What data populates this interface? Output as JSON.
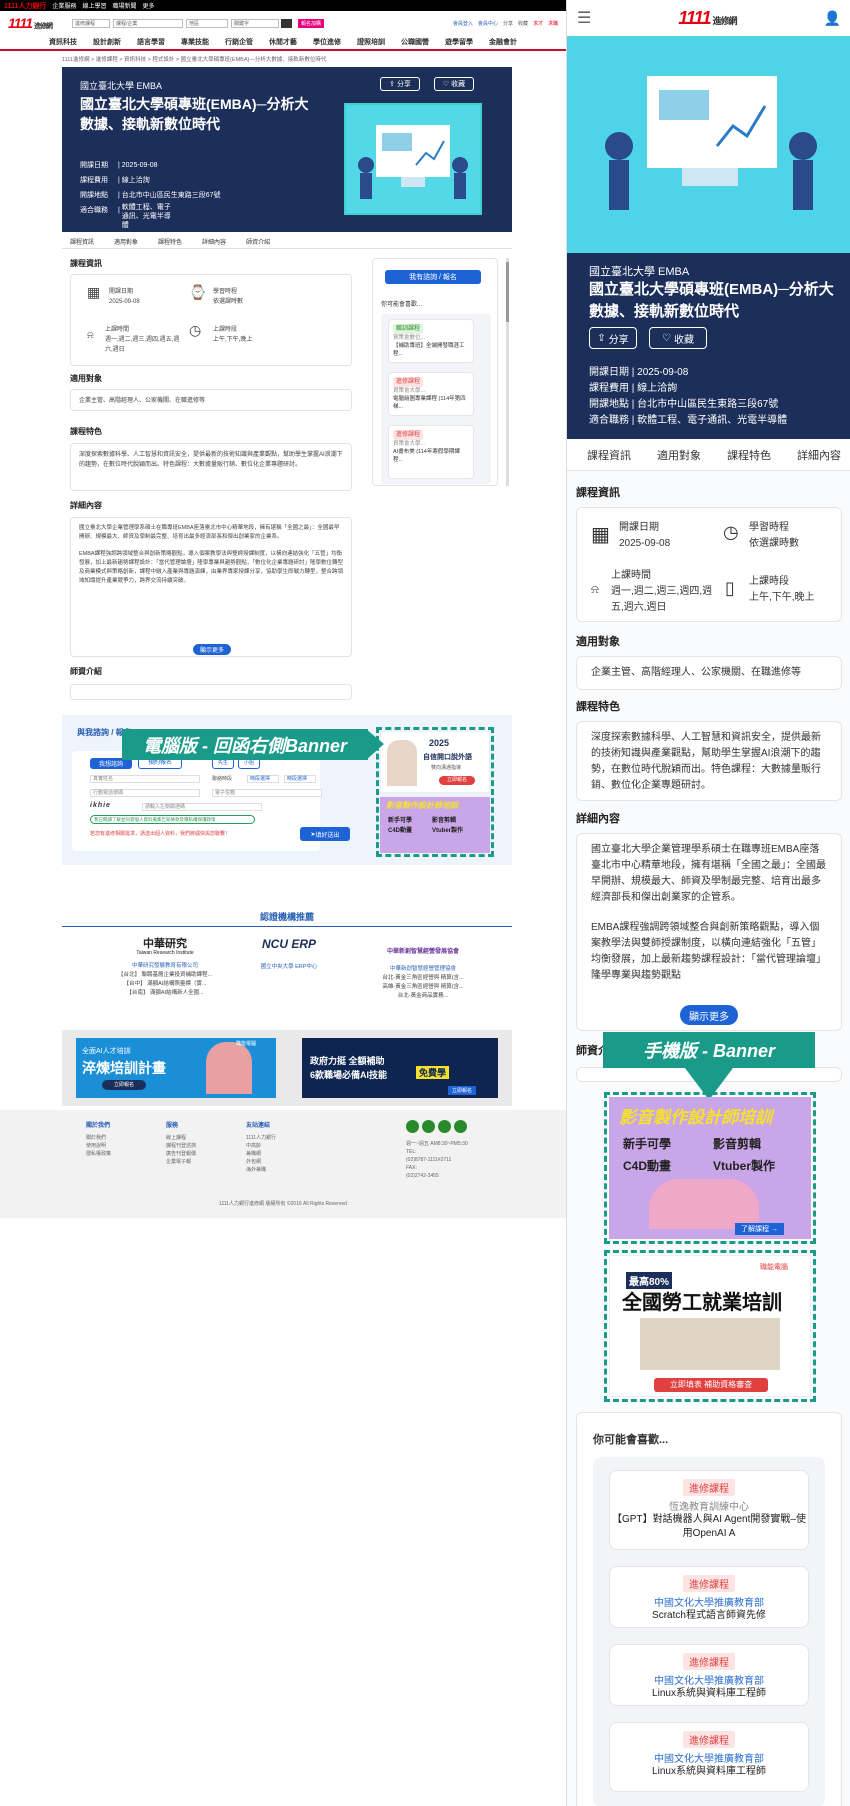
{
  "colors": {
    "navy": "#1c2f5a",
    "brand_red": "#e60012",
    "teal": "#1a9b8a",
    "blue": "#1e63d6",
    "cyan": "#4ed3e8"
  },
  "desktop": {
    "topstrip": [
      "1111人力銀行",
      "企業服務",
      "線上學習",
      "職場新聞",
      "更多"
    ],
    "logo": "1111",
    "logo_sub": "進修網",
    "header": {
      "select1": "進修課程",
      "select2": "課程/企業",
      "select3": "地區",
      "search_placeholder": "關鍵字",
      "pill": "報名加購",
      "links": [
        "會員登入",
        "會員中心",
        "分享",
        "收藏",
        "求才",
        "求職"
      ]
    },
    "nav": [
      "資訊科技",
      "設計創新",
      "語言學習",
      "專業技能",
      "行銷企管",
      "休閒才藝",
      "學位進修",
      "證照培訓",
      "公職國營",
      "遊學留學",
      "金融會計"
    ],
    "breadcrumb": "1111進修網 > 進修課程 > 資訊科技 > 程式設計 > 國立臺北大學碩專班(EMBA)—分析大數據、接軌新數位時代",
    "hero": {
      "school": "國立臺北大學 EMBA",
      "title": "國立臺北大學碩專班(EMBA)─分析大數據、接軌新數位時代",
      "share": "分享",
      "fav": "收藏",
      "info": [
        {
          "k": "開課日期",
          "v": "2025-09-08"
        },
        {
          "k": "課程費用",
          "v": "線上洽詢"
        },
        {
          "k": "開課地點",
          "v": "台北市中山區民生東路三段67號"
        },
        {
          "k": "適合職務",
          "v": "軟體工程、電子通訊、光電半導體"
        }
      ]
    },
    "tabs": [
      "課程資訊",
      "適用對象",
      "課程特色",
      "詳細內容",
      "師資介紹"
    ],
    "course_info": {
      "title": "課程資訊",
      "start_label": "開課日期",
      "start_value": "2025-09-08",
      "hours_label": "學習時程",
      "hours_value": "依選課時數",
      "days_label": "上課時間",
      "days_value": "週一,週二,週三,週四,週五,週六,週日",
      "period_label": "上課時段",
      "period_value": "上午,下午,晚上"
    },
    "target": {
      "title": "適用對象",
      "text": "企業主管、高階經理人、公家機關、在職進修等"
    },
    "feature": {
      "title": "課程特色",
      "text": "深度探索數據科學、人工智慧和資訊安全，提供最新的技術知識與產業觀點，幫助學生掌握AI浪潮下的趨勢，在數位時代脫穎而出。特色課程：大數據量販行銷、數位化企業專題研討。"
    },
    "detail": {
      "title": "詳細內容",
      "text1": "國立臺北大學企業管理學系碩士在職專班EMBA座落臺北市中心精華地段，擁有堪稱「全國之最」：全國最早開辦、規模最大、師資及學制最完整、培育出最多經濟部長和傑出創業家的企業系。",
      "text2": "EMBA課程強調跨領域整合與創新策略觀點，導入個案教學法與雙師授課制度，以橫向連結強化「五管」均衡發展，加上最新趨勢課程設計：「當代管理論壇」隆學專業與趨勢觀點，「數位化企業專題研討」隆學數位轉型及商業模式與策略創新，課程中融入產業與專題演練，由業界專家授課分享，協助學生即戰力轉型，整合跨領域知識提升產業競爭力，跨界交流持續突破。",
      "more": "顯示更多"
    },
    "teacher": {
      "title": "師資介紹"
    },
    "side": {
      "apply": "我有諮詢 / 報名",
      "like_title": "你可能會喜歡...",
      "cards": [
        {
          "tag": "職訓課程",
          "org": "資策會數位...",
          "title": "【補助專班】全端開發職涯工程..."
        },
        {
          "tag": "進修課程",
          "org": "資策會大學...",
          "title": "電腦繪圖專業課程 (114年第四梯..."
        },
        {
          "tag": "進修課程",
          "org": "資策會大學...",
          "title": "AI畫布美 (114年寒假學期課程..."
        }
      ]
    },
    "form": {
      "title": "與我諮詢 / 報名",
      "tab1": "我想諮詢",
      "tab2": "預約報名",
      "gender1": "先生",
      "gender2": "小姐",
      "name_ph": "真實姓名",
      "time_label": "聯絡時段",
      "time1": "時段選擇",
      "time2": "時段選擇",
      "phone_ph": "行動電話號碼",
      "email_ph": "電子信箱",
      "captcha": "ikhie",
      "captcha_ph": "請輸入左側驗證碼",
      "agree": "我已閱讀了解並同意個人資料蒐集告知條款及隱私權保護政策",
      "note": "若您有進修相關需求，請送出個人資料，我們將儘快與您聯繫！",
      "submit": "填好送出"
    },
    "banner_label": "電腦版 - 回函右側Banner",
    "ad1": {
      "year": "2025",
      "title": "自信開口說外語",
      "sub": "雙向溝通指導",
      "cta": "立即報名"
    },
    "ad2": {
      "title": "影音製作設計師培訓",
      "items": [
        "新手可學",
        "影音剪輯",
        "C4D動畫",
        "Vtuber製作"
      ]
    },
    "cert": {
      "title": "認證機構推薦",
      "items": [
        {
          "name": "中華研究",
          "en": "Taiwan Research Institute",
          "org": "中華研究發展教育有限公司",
          "l1": "【台北】 聯聘基層企業投資補助課程...",
          "l2": "【台中】 滿額AI結構照量標（實...",
          "l3": "【台南】 滿額AI結構新人全國...",
          "logo": "中華研究"
        },
        {
          "name": "NCU ERP",
          "en": "",
          "org": "國立中央大學 ERP中心",
          "l1": "",
          "l2": "",
          "l3": "",
          "logo": "ERP"
        },
        {
          "name": "中華新創智慧經營發展協會",
          "en": "",
          "org": "中華新創智慧經營管理協會",
          "l1": "台北-黃金三角區經營與 精算(含...",
          "l2": "高雄-黃金三角區經營與 精算(含...",
          "l3": "台北-黃金商品實務...",
          "logo": "協會"
        }
      ]
    },
    "ad3": {
      "a": "全面AI人才培訓",
      "b": "淬煉培訓計畫",
      "c": "立即報名",
      "tag": "職能電腦"
    },
    "ad4": {
      "a": "政府力挺 全額補助",
      "b": "6款職場必備AI技能",
      "c": "免費學",
      "d": "立即報名"
    },
    "footer": {
      "c1": {
        "t": "關於我們",
        "items": [
          "關於我們",
          "使用說明",
          "隱私權政策"
        ]
      },
      "c2": {
        "t": "服務",
        "items": [
          "線上課程",
          "課程刊登諮詢",
          "廣告刊登報價",
          "企業電子報"
        ]
      },
      "c3": {
        "t": "友站連結",
        "items": [
          "1111人力銀行",
          "中高齡",
          "兼職網",
          "外包網",
          "海外兼職"
        ]
      },
      "contact": [
        "週一~週五 AM8:30~PM5:30",
        "TEL:",
        "(02)8787-1111#2711",
        "FAX:",
        "(02)2742-3455"
      ],
      "copy": "1111人力銀行進修網 版權所有    ©2016 All Rights Reserved"
    }
  },
  "mobile": {
    "logo": "1111",
    "logo_sub": "進修網",
    "hero": {
      "school": "國立臺北大學 EMBA",
      "title": "國立臺北大學碩專班(EMBA)─分析大數據、接軌新數位時代",
      "share": "分享",
      "fav": "收藏",
      "info": [
        {
          "k": "開課日期",
          "v": "2025-09-08"
        },
        {
          "k": "課程費用",
          "v": "線上洽詢"
        },
        {
          "k": "開課地點",
          "v": "台北市中山區民生東路三段67號"
        },
        {
          "k": "適合職務",
          "v": "軟體工程、電子通訊、光電半導體"
        }
      ]
    },
    "tabs": [
      "課程資訊",
      "適用對象",
      "課程特色",
      "詳細內容"
    ],
    "course_info": {
      "title": "課程資訊",
      "start_label": "開課日期",
      "start_value": "2025-09-08",
      "hours_label": "學習時程",
      "hours_value": "依選課時數",
      "days_label": "上課時間",
      "days_value": "週一,週二,週三,週四,週五,週六,週日",
      "period_label": "上課時段",
      "period_value": "上午,下午,晚上"
    },
    "target": {
      "title": "適用對象",
      "text": "企業主管、高階經理人、公家機關、在職進修等"
    },
    "feature": {
      "title": "課程特色",
      "text": "深度探索數據科學、人工智慧和資訊安全，提供最新的技術知識與產業觀點，幫助學生掌握AI浪潮下的趨勢，在數位時代脫穎而出。特色課程：大數據量販行銷、數位化企業專題研討。"
    },
    "detail": {
      "title": "詳細內容",
      "text1": "國立臺北大學企業管理學系碩士在職專班EMBA座落臺北市中心精華地段，擁有堪稱「全國之最」：全國最早開辦、規模最大、師資及學制最完整、培育出最多經濟部長和傑出創業家的企管系。",
      "text2": "EMBA課程強調跨領域整合與創新策略觀點，導入個案教學法與雙師授課制度，以橫向連結強化「五管」均衡發展，加上最新趨勢課程設計：「當代管理論壇」隆學專業與趨勢觀點",
      "more": "顯示更多"
    },
    "teacher": {
      "title": "師資介紹"
    },
    "banner_label": "手機版 - Banner",
    "ad1": {
      "title": "影音製作設計師培訓",
      "items": [
        "新手可學",
        "影音剪輯",
        "C4D動畫",
        "Vtuber製作"
      ],
      "cta": "了解課程 →"
    },
    "ad2": {
      "tag": "職能電腦",
      "pct": "最高80%",
      "title": "全國勞工就業培訓",
      "cta": "立即填表 補助資格審查"
    },
    "like_title": "你可能會喜歡...",
    "cards": [
      {
        "tag": "進修課程",
        "org": "恆逸教育訓練中心",
        "title": "【GPT】對話機器人與AI Agent開發實戰–使用OpenAI A"
      },
      {
        "tag": "進修課程",
        "org": "中國文化大學推廣教育部",
        "title": "Scratch程式語言師資先修"
      },
      {
        "tag": "進修課程",
        "org": "中國文化大學推廣教育部",
        "title": "Linux系統與資料庫工程師"
      },
      {
        "tag": "進修課程",
        "org": "中國文化大學推廣教育部",
        "title": "Linux系統與資料庫工程師"
      }
    ]
  }
}
